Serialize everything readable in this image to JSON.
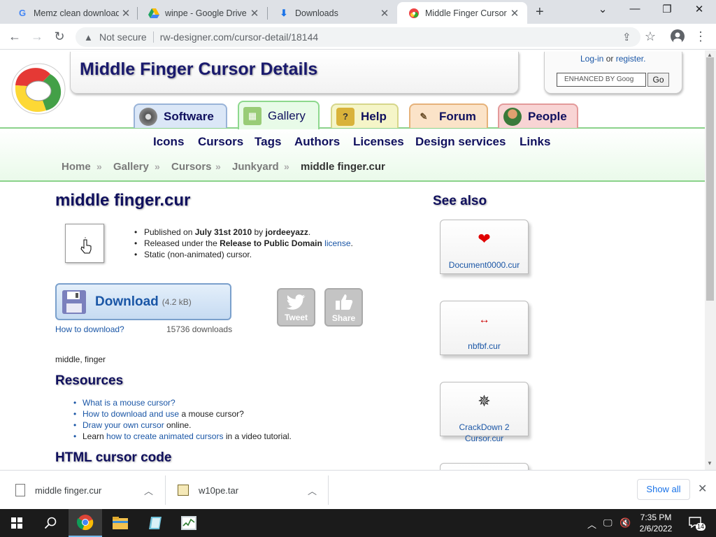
{
  "browser": {
    "tabs": [
      {
        "title": "Memz clean download",
        "icon": "google-icon"
      },
      {
        "title": "winpe - Google Drive",
        "icon": "google-drive-icon"
      },
      {
        "title": "Downloads",
        "icon": "download-icon"
      },
      {
        "title": "Middle Finger Cursor",
        "icon": "rw-designer-icon",
        "active": true
      }
    ],
    "security_label": "Not secure",
    "url": "rw-designer.com/cursor-detail/18144"
  },
  "header": {
    "title": "Middle Finger Cursor Details",
    "login_label": "Log-in",
    "login_or": "or",
    "register_label": "register.",
    "search_placeholder": "ENHANCED BY Goog",
    "search_go": "Go"
  },
  "main_tabs": [
    {
      "label": "Software"
    },
    {
      "label": "Gallery",
      "active": true
    },
    {
      "label": "Help"
    },
    {
      "label": "Forum"
    },
    {
      "label": "People"
    }
  ],
  "nav": [
    "Icons",
    "Cursors",
    "Tags",
    "Authors",
    "Licenses",
    "Design services",
    "Links"
  ],
  "breadcrumb": [
    "Home",
    "Gallery",
    "Cursors",
    "Junkyard",
    "middle finger.cur"
  ],
  "cursor": {
    "name": "middle finger.cur",
    "published_prefix": "Published on",
    "date": "July 31st 2010",
    "by": "by",
    "author": "jordeeyazz",
    "released_prefix": "Released under the",
    "license_name": "Release to Public Domain",
    "license_link": "license",
    "static_note": "Static (non-animated) cursor.",
    "download_label": "Download",
    "download_size": "(4.2 kB)",
    "how_to_download": "How to download?",
    "download_count": "15736 downloads",
    "tweet_label": "Tweet",
    "share_label": "Share",
    "tags": "middle, finger"
  },
  "resources": {
    "title": "Resources",
    "items": [
      {
        "link": "What is a mouse cursor?",
        "rest": ""
      },
      {
        "link": "How to download and use",
        "rest": "a mouse cursor?"
      },
      {
        "link": "Draw your own cursor",
        "rest": "online."
      },
      {
        "pre": "Learn",
        "link": "how to create animated cursors",
        "rest": "in a video tutorial."
      }
    ]
  },
  "html_code_title": "HTML cursor code",
  "see_also": {
    "title": "See also",
    "items": [
      {
        "name": "Document0000.cur"
      },
      {
        "name": "nbfbf.cur"
      },
      {
        "name": "CrackDown 2 Cursor.cur"
      }
    ]
  },
  "downloads_bar": {
    "items": [
      {
        "name": "middle finger.cur"
      },
      {
        "name": "w10pe.tar"
      }
    ],
    "show_all": "Show all"
  },
  "taskbar": {
    "time": "7:35 PM",
    "date": "2/6/2022",
    "notification_count": "14"
  },
  "colors": {
    "heading": "#10105e",
    "link": "#1a56a6",
    "nav_green": "#8ad28a"
  }
}
